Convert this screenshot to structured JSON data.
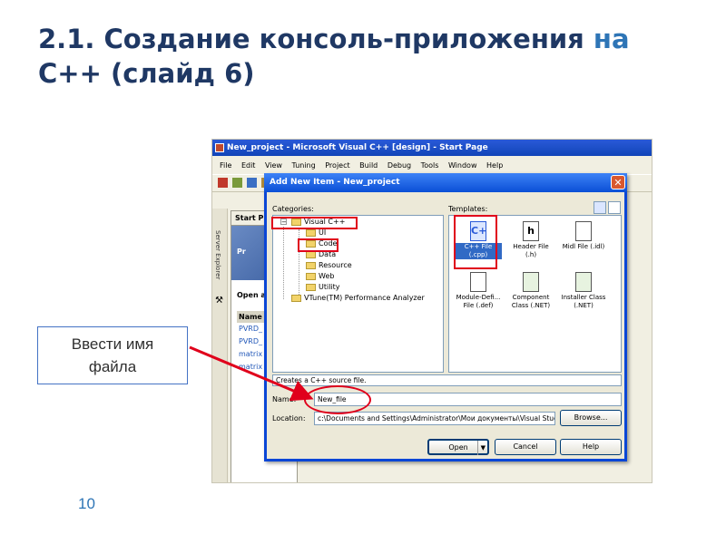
{
  "slide": {
    "title_main": "2.1. Создание консоль-приложения",
    "title_accent": "на",
    "title_line2": "C++ (слайд 6)",
    "page_number": "10"
  },
  "callout": {
    "line1": "Ввести имя",
    "line2": "файла"
  },
  "ide": {
    "window_title": "New_project - Microsoft Visual C++ [design] - Start Page",
    "menu": [
      "File",
      "Edit",
      "View",
      "Tuning",
      "Project",
      "Build",
      "Debug",
      "Tools",
      "Window",
      "Help"
    ],
    "side_tab": "Server Explorer",
    "start_page_tab": "Start P",
    "banner_label": "Pr",
    "open_label": "Open a",
    "table_header": "Name",
    "table_rows": [
      "PVRD_",
      "PVRD_",
      "matrix",
      "matrix"
    ]
  },
  "dialog": {
    "title": "Add New Item - New_project",
    "close_symbol": "✕",
    "categories_label": "Categories:",
    "templates_label": "Templates:",
    "categories": {
      "root": "Visual C++",
      "children": [
        "UI",
        "Code",
        "Data",
        "Resource",
        "Web",
        "Utility"
      ],
      "second_root": "VTune(TM) Performance Analyzer"
    },
    "templates": [
      {
        "line1": "C++ File",
        "line2": "(.cpp)",
        "glyph": "C+",
        "selected": true
      },
      {
        "line1": "Header File",
        "line2": "(.h)",
        "glyph": "h",
        "selected": false
      },
      {
        "line1": "Midl File (.idl)",
        "line2": "",
        "glyph": "",
        "selected": false
      },
      {
        "line1": "Module-Defi...",
        "line2": "File (.def)",
        "glyph": "",
        "selected": false
      },
      {
        "line1": "Component",
        "line2": "Class (.NET)",
        "glyph": "",
        "selected": false
      },
      {
        "line1": "Installer Class",
        "line2": "(.NET)",
        "glyph": "",
        "selected": false
      }
    ],
    "description": "Creates a C++ source file.",
    "name_label": "Name:",
    "name_value": "New_file",
    "location_label": "Location:",
    "location_value": "c:\\Documents and Settings\\Administrator\\Мои документы\\Visual Stuc",
    "browse_label": "Browse...",
    "open_label": "Open",
    "cancel_label": "Cancel",
    "help_label": "Help"
  },
  "colors": {
    "annotation_red": "#e0001b",
    "title_dark": "#1f3864",
    "title_accent": "#2e75b6"
  }
}
